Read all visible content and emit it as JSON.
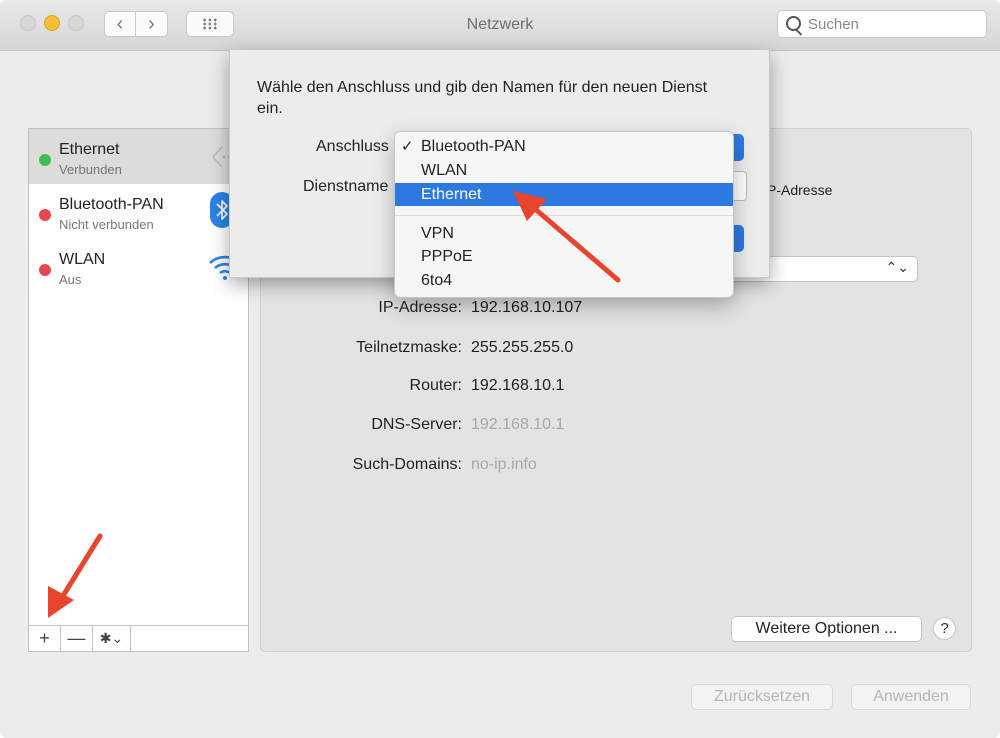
{
  "window": {
    "title": "Netzwerk",
    "search_placeholder": "Suchen",
    "nav_back": "‹",
    "nav_forward": "›"
  },
  "sidebar": {
    "services": [
      {
        "name": "Ethernet",
        "status": "Verbunden",
        "dot_color": "#3ebc4e",
        "icon": "ethernet-arrows-icon"
      },
      {
        "name": "Bluetooth-PAN",
        "status": "Nicht verbunden",
        "dot_color": "#e5484d",
        "icon": "bluetooth-icon"
      },
      {
        "name": "WLAN",
        "status": "Aus",
        "dot_color": "#e5484d",
        "icon": "wifi-icon"
      }
    ],
    "add_label": "+",
    "remove_label": "—",
    "actions_label": "✱⌄"
  },
  "details": {
    "ip_label": "IP-Adresse:",
    "ip_value": "192.168.10.107",
    "subnet_label": "Teilnetzmaske:",
    "subnet_value": "255.255.255.0",
    "router_label": "Router:",
    "router_value": "192.168.10.1",
    "dns_label": "DNS-Server:",
    "dns_value": "192.168.10.1",
    "search_domains_label": "Such-Domains:",
    "search_domains_value": "no-ip.info",
    "ip_address_partial": "P-Adresse",
    "more_options": "Weitere Optionen ...",
    "help": "?"
  },
  "footer": {
    "reset": "Zurücksetzen",
    "apply": "Anwenden"
  },
  "sheet": {
    "prompt": "Wähle den Anschluss und gib den Namen für den neuen Dienst ein.",
    "interface_label": "Anschluss",
    "service_name_label": "Dienstname"
  },
  "dropdown": {
    "group1": [
      "Bluetooth-PAN",
      "WLAN",
      "Ethernet"
    ],
    "group2": [
      "VPN",
      "PPPoE",
      "6to4"
    ],
    "checked": "Bluetooth-PAN",
    "highlighted": "Ethernet",
    "check_mark": "✓",
    "highlight_color": "#2c7ae0"
  },
  "annotation_color": "#e8452c"
}
